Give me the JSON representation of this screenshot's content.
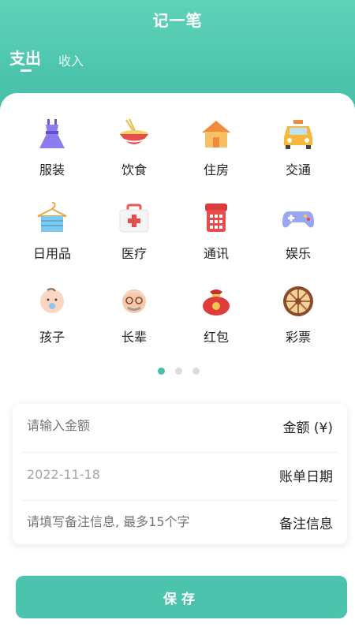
{
  "header": {
    "title": "记一笔"
  },
  "tabs": [
    {
      "label": "支出",
      "active": true
    },
    {
      "label": "收入",
      "active": false
    }
  ],
  "categories": [
    {
      "label": "服装",
      "icon": "dress-icon"
    },
    {
      "label": "饮食",
      "icon": "noodle-bowl-icon"
    },
    {
      "label": "住房",
      "icon": "house-icon"
    },
    {
      "label": "交通",
      "icon": "taxi-icon"
    },
    {
      "label": "日用品",
      "icon": "towel-hanger-icon"
    },
    {
      "label": "医疗",
      "icon": "medical-kit-icon"
    },
    {
      "label": "通讯",
      "icon": "telephone-icon"
    },
    {
      "label": "娱乐",
      "icon": "gamepad-icon"
    },
    {
      "label": "孩子",
      "icon": "baby-icon"
    },
    {
      "label": "长辈",
      "icon": "elder-icon"
    },
    {
      "label": "红包",
      "icon": "red-envelope-pouch-icon"
    },
    {
      "label": "彩票",
      "icon": "lottery-wheel-icon"
    }
  ],
  "pager": {
    "count": 3,
    "active_index": 0
  },
  "form": {
    "amount": {
      "placeholder": "请输入金额",
      "label": "金额 (¥)"
    },
    "date": {
      "value": "2022-11-18",
      "label": "账单日期"
    },
    "note": {
      "placeholder": "请填写备注信息, 最多15个字",
      "label": "备注信息"
    }
  },
  "save_label": "保存",
  "colors": {
    "accent": "#4cc4ad",
    "header_top": "#5fd3b8"
  }
}
